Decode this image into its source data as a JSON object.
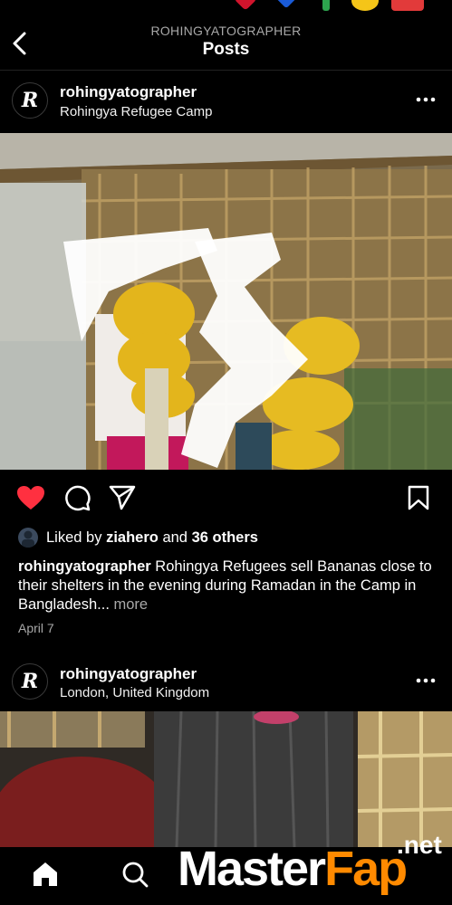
{
  "header": {
    "subtitle": "ROHINGYATOGRAPHER",
    "title": "Posts"
  },
  "posts": [
    {
      "username": "rohingyatographer",
      "location": "Rohingya Refugee Camp",
      "avatar_letter": "R",
      "liked_by_user": "ziahero",
      "liked_others": "36 others",
      "liked_prefix": "Liked by",
      "liked_and": "and",
      "caption_user": "rohingyatographer",
      "caption_text": "Rohingya Refugees sell Bananas close to their shelters in the evening during Ramadan in the Camp in Bangladesh...",
      "caption_more": "more",
      "date": "April 7",
      "liked": true
    },
    {
      "username": "rohingyatographer",
      "location": "London, United Kingdom",
      "avatar_letter": "R"
    }
  ],
  "icons": {
    "back": "chevron-left-icon",
    "more": "more-dots-icon",
    "like": "heart-icon",
    "comment": "comment-icon",
    "share": "send-icon",
    "save": "bookmark-icon",
    "home": "home-icon",
    "search": "search-icon"
  },
  "colors": {
    "like": "#ff3040",
    "background": "#000000",
    "secondary_text": "#a8a8a8"
  },
  "watermark": {
    "master": "Master",
    "fap": "Fap",
    "net": ".net"
  }
}
